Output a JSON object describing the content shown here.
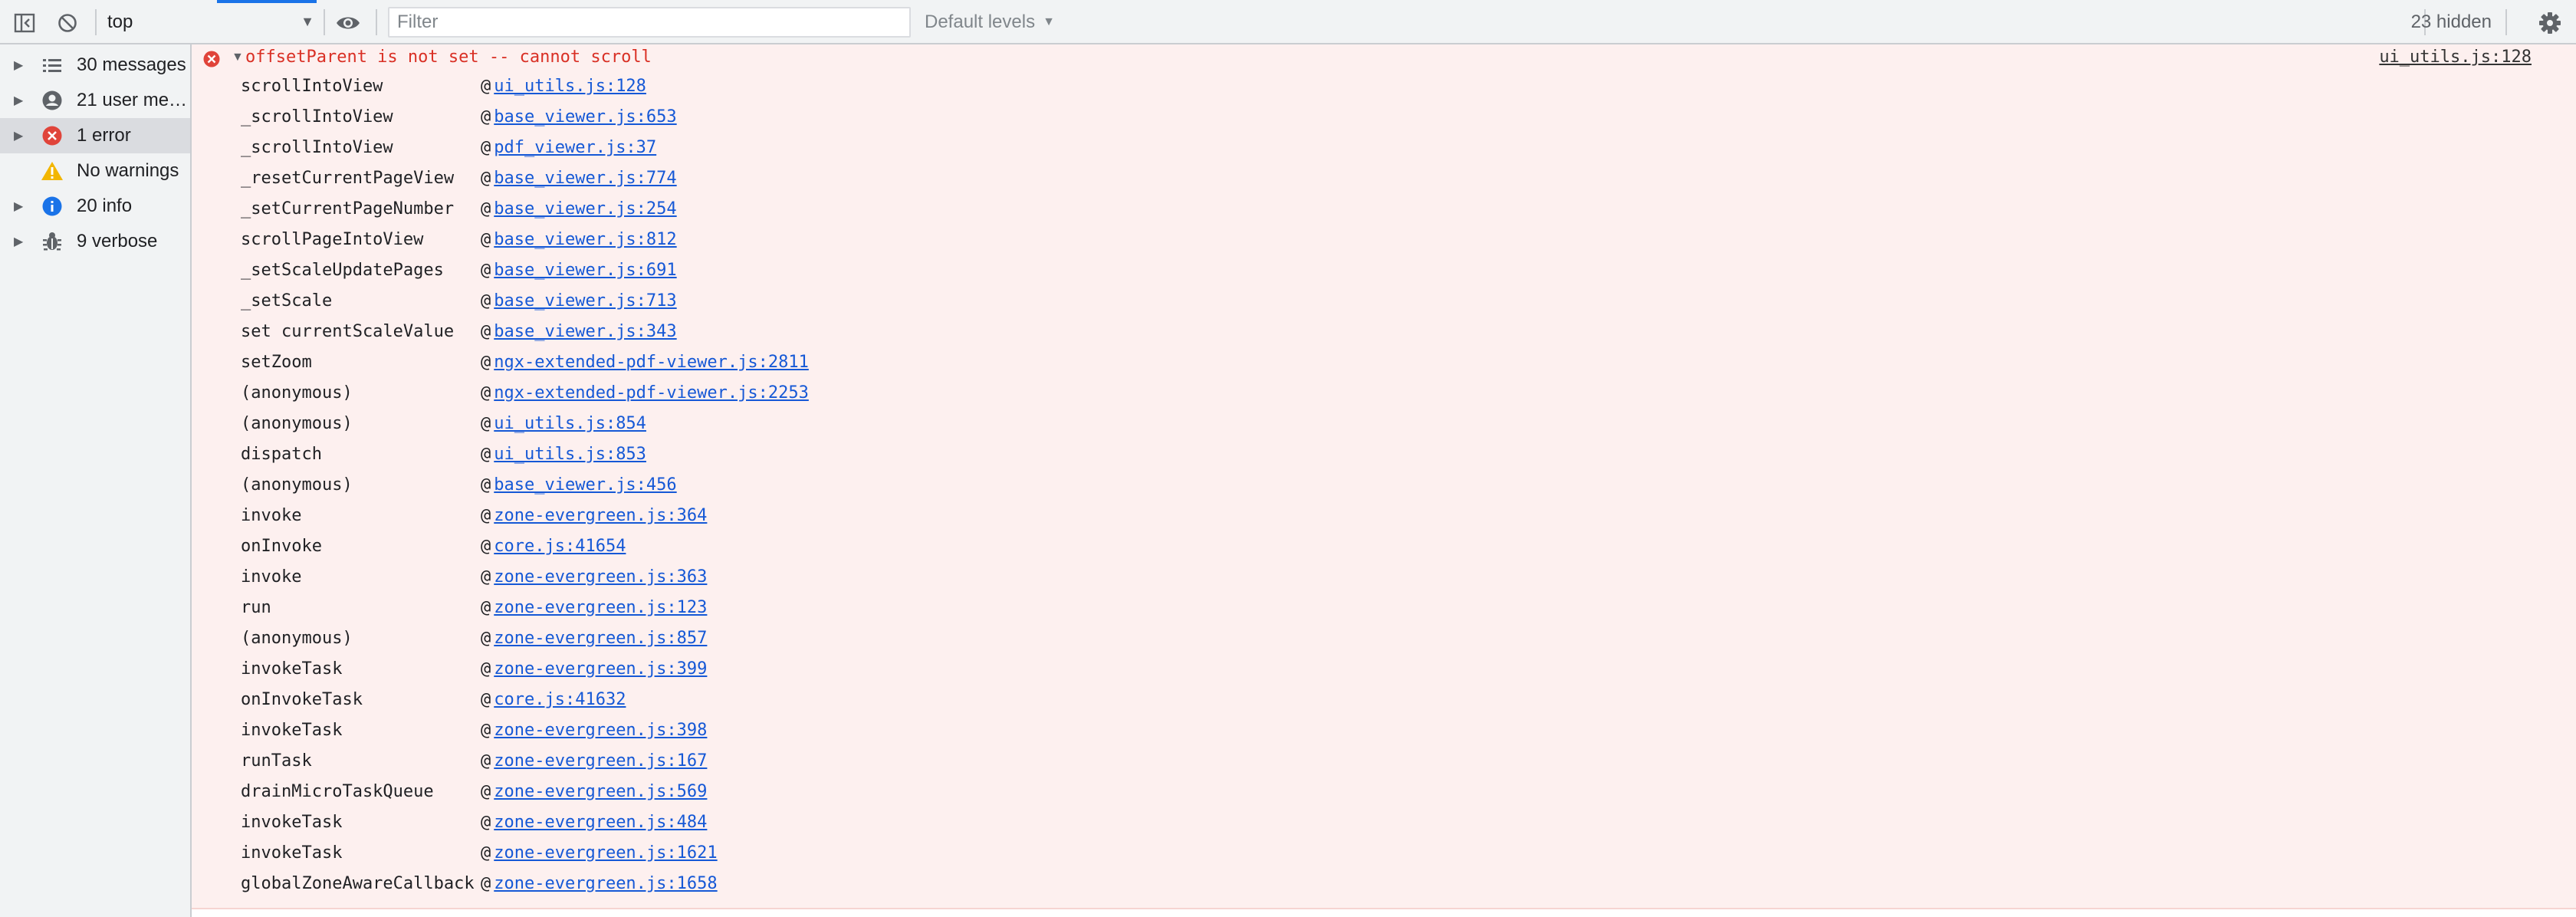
{
  "toolbar": {
    "context": "top",
    "filter_placeholder": "Filter",
    "levels_label": "Default levels",
    "hidden_count": "23 hidden"
  },
  "sidebar": {
    "items": [
      {
        "label": "30 messages",
        "icon": "list-icon",
        "expandable": true,
        "selected": false
      },
      {
        "label": "21 user me…",
        "icon": "user-icon",
        "expandable": true,
        "selected": false
      },
      {
        "label": "1 error",
        "icon": "error-icon",
        "expandable": true,
        "selected": true
      },
      {
        "label": "No warnings",
        "icon": "warning-icon",
        "expandable": false,
        "selected": false
      },
      {
        "label": "20 info",
        "icon": "info-icon",
        "expandable": true,
        "selected": false
      },
      {
        "label": "9 verbose",
        "icon": "bug-icon",
        "expandable": true,
        "selected": false
      }
    ]
  },
  "console": {
    "error": {
      "message": "offsetParent is not set -- cannot scroll",
      "source": "ui_utils.js:128",
      "color": "#d93025"
    },
    "stack": [
      {
        "fn": "scrollIntoView",
        "loc": "ui_utils.js:128"
      },
      {
        "fn": "_scrollIntoView",
        "loc": "base_viewer.js:653"
      },
      {
        "fn": "_scrollIntoView",
        "loc": "pdf_viewer.js:37"
      },
      {
        "fn": "_resetCurrentPageView",
        "loc": "base_viewer.js:774"
      },
      {
        "fn": "_setCurrentPageNumber",
        "loc": "base_viewer.js:254"
      },
      {
        "fn": "scrollPageIntoView",
        "loc": "base_viewer.js:812"
      },
      {
        "fn": "_setScaleUpdatePages",
        "loc": "base_viewer.js:691"
      },
      {
        "fn": "_setScale",
        "loc": "base_viewer.js:713"
      },
      {
        "fn": "set currentScaleValue",
        "loc": "base_viewer.js:343"
      },
      {
        "fn": "setZoom",
        "loc": "ngx-extended-pdf-viewer.js:2811"
      },
      {
        "fn": "(anonymous)",
        "loc": "ngx-extended-pdf-viewer.js:2253"
      },
      {
        "fn": "(anonymous)",
        "loc": "ui_utils.js:854"
      },
      {
        "fn": "dispatch",
        "loc": "ui_utils.js:853"
      },
      {
        "fn": "(anonymous)",
        "loc": "base_viewer.js:456"
      },
      {
        "fn": "invoke",
        "loc": "zone-evergreen.js:364"
      },
      {
        "fn": "onInvoke",
        "loc": "core.js:41654"
      },
      {
        "fn": "invoke",
        "loc": "zone-evergreen.js:363"
      },
      {
        "fn": "run",
        "loc": "zone-evergreen.js:123"
      },
      {
        "fn": "(anonymous)",
        "loc": "zone-evergreen.js:857"
      },
      {
        "fn": "invokeTask",
        "loc": "zone-evergreen.js:399"
      },
      {
        "fn": "onInvokeTask",
        "loc": "core.js:41632"
      },
      {
        "fn": "invokeTask",
        "loc": "zone-evergreen.js:398"
      },
      {
        "fn": "runTask",
        "loc": "zone-evergreen.js:167"
      },
      {
        "fn": "drainMicroTaskQueue",
        "loc": "zone-evergreen.js:569"
      },
      {
        "fn": "invokeTask",
        "loc": "zone-evergreen.js:484"
      },
      {
        "fn": "invokeTask",
        "loc": "zone-evergreen.js:1621"
      },
      {
        "fn": "globalZoneAwareCallback",
        "loc": "zone-evergreen.js:1658"
      }
    ]
  },
  "colors": {
    "error_bg": "#fdf0ef",
    "link": "#1558d6",
    "accent": "#1a73e8"
  }
}
